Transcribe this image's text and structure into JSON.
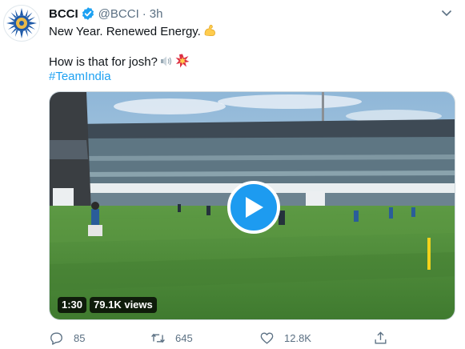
{
  "tweet": {
    "display_name": "BCCI",
    "handle": "@BCCI",
    "separator": "·",
    "time": "3h",
    "line1": "New Year. Renewed Energy.",
    "line2": "How is that for josh?",
    "hashtag": "#TeamIndia",
    "icons": {
      "verified": "verified-badge-icon",
      "more": "more-caret-icon",
      "emoji_strong": "flexed-biceps-emoji",
      "emoji_speaker": "speaker-emoji",
      "emoji_collision": "collision-emoji"
    }
  },
  "video": {
    "duration": "1:30",
    "views": "79.1K views"
  },
  "actions": {
    "reply_count": "85",
    "retweet_count": "645",
    "like_count": "12.8K"
  },
  "colors": {
    "accent": "#1da1f2",
    "secondary_text": "#5b7083",
    "field_green": "#4e8a3a"
  }
}
